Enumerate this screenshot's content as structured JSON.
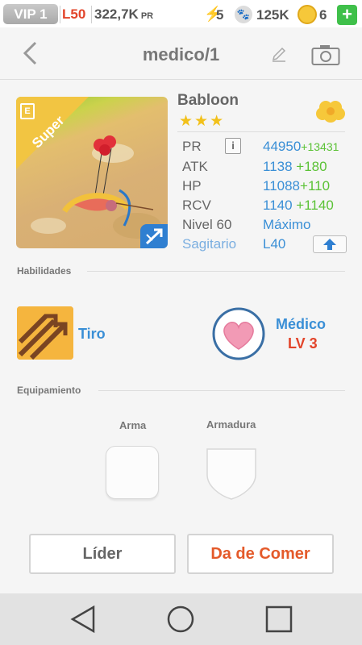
{
  "status_bar": {
    "vip": "VIP 1",
    "level": "L50",
    "pr": "322,7K",
    "pr_unit": "PR",
    "energy": "5",
    "paws": "125K",
    "coins": "6",
    "plus": "+"
  },
  "header": {
    "title": "medico/1",
    "icons": [
      "back-icon",
      "edit-icon",
      "camera-icon"
    ]
  },
  "unit": {
    "rarity_tag": "Super",
    "name": "Babloon",
    "stars": "★★★",
    "stats": [
      {
        "label": "PR",
        "value": "44950",
        "bonus": "+13431"
      },
      {
        "label": "ATK",
        "value": "1138",
        "bonus": "+180"
      },
      {
        "label": "HP",
        "value": "11088",
        "bonus": "+110"
      },
      {
        "label": "RCV",
        "value": "1140",
        "bonus": "+1140"
      },
      {
        "label": "Nivel 60",
        "value": "Máximo",
        "bonus": ""
      },
      {
        "label": "Sagitario",
        "value": "L40",
        "bonus": ""
      }
    ],
    "info_glyph": "i"
  },
  "sections": {
    "skills": "Habilidades",
    "equipment": "Equipamiento"
  },
  "skills": {
    "skill1": {
      "name": "Tiro"
    },
    "skill2": {
      "name": "Médico",
      "level": "LV 3"
    }
  },
  "equipment": {
    "weapon_label": "Arma",
    "armor_label": "Armadura"
  },
  "buttons": {
    "leader": "Líder",
    "feed": "Da de Comer"
  },
  "colors": {
    "accent_blue": "#3a8fd6",
    "bonus_green": "#5bc236",
    "alert_red": "#e2442a"
  }
}
